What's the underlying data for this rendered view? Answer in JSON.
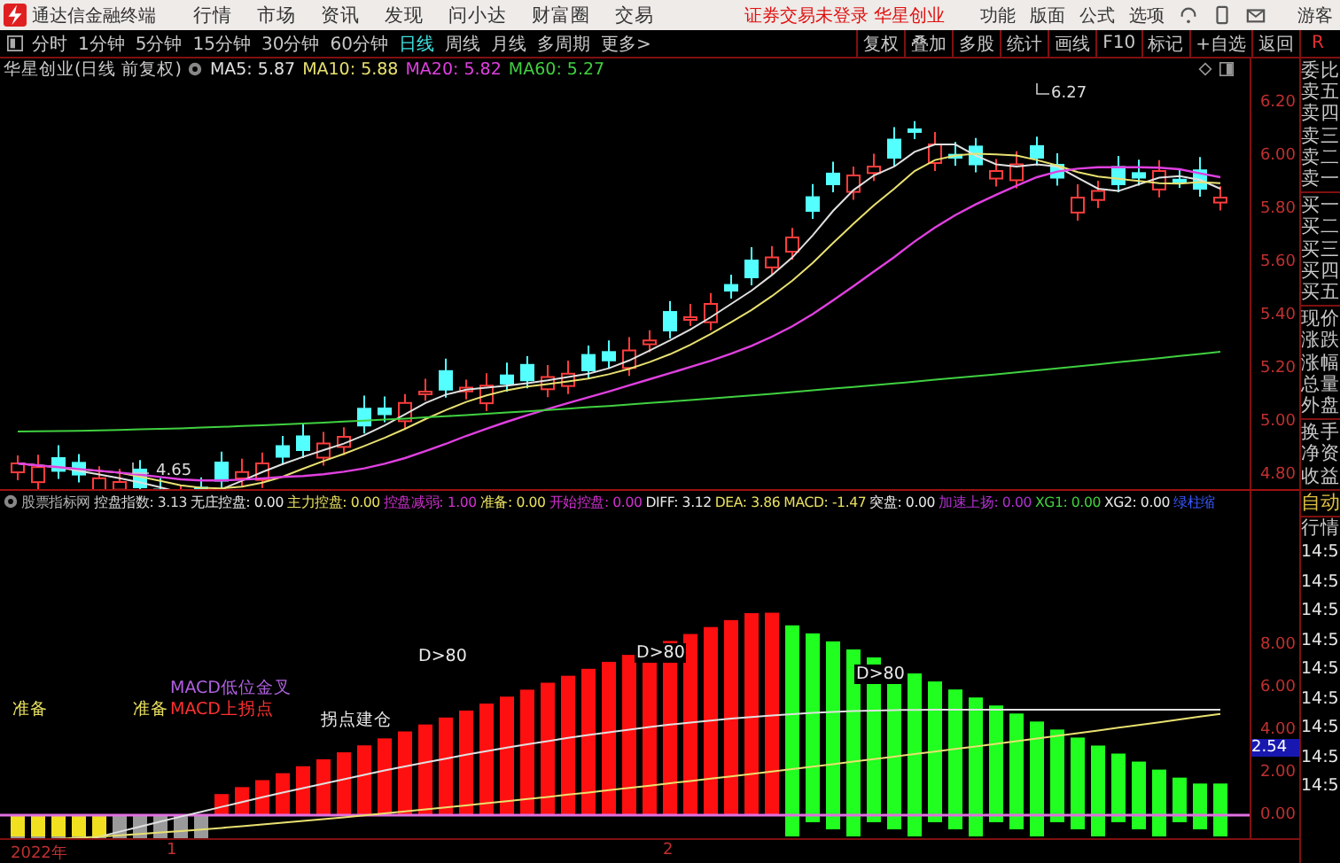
{
  "app": {
    "title": "通达信金融终端"
  },
  "menu": [
    "行情",
    "市场",
    "资讯",
    "发现",
    "问小达",
    "财富圈",
    "交易"
  ],
  "login_notice": "证券交易未登录 华星创业",
  "menu_right": [
    "功能",
    "版面",
    "公式",
    "选项"
  ],
  "user": "游客",
  "period_tabs": [
    {
      "label": "分时",
      "selected": false
    },
    {
      "label": "1分钟",
      "selected": false
    },
    {
      "label": "5分钟",
      "selected": false
    },
    {
      "label": "15分钟",
      "selected": false
    },
    {
      "label": "30分钟",
      "selected": false
    },
    {
      "label": "60分钟",
      "selected": false
    },
    {
      "label": "日线",
      "selected": true
    },
    {
      "label": "周线",
      "selected": false
    },
    {
      "label": "月线",
      "selected": false
    },
    {
      "label": "多周期",
      "selected": false
    },
    {
      "label": "更多>",
      "selected": false
    }
  ],
  "toolbar_buttons": [
    "复权",
    "叠加",
    "多股",
    "统计",
    "画线",
    "F10",
    "标记",
    "+自选",
    "返回"
  ],
  "toolbar_right": "R",
  "main_chart": {
    "title": "华星创业(日线 前复权)",
    "indicators": [
      {
        "label": "MA5: 5.87",
        "color": "#e0e0e0"
      },
      {
        "label": "MA10: 5.88",
        "color": "#e8e070"
      },
      {
        "label": "MA20: 5.82",
        "color": "#e040e0"
      },
      {
        "label": "MA60: 5.27",
        "color": "#40d040"
      }
    ],
    "high_label": "6.27",
    "low_label": "4.65",
    "axis_labels": [
      "6.20",
      "6.00",
      "5.80",
      "5.60",
      "5.40",
      "5.20",
      "5.00",
      "4.80"
    ]
  },
  "indicator_panel": {
    "items": [
      {
        "label": "股票指标网",
        "color": "#b0b0b0"
      },
      {
        "label": "控盘指数: 3.13",
        "color": "#d8d8d8"
      },
      {
        "label": "无庄控盘: 0.00",
        "color": "#e8e8e8"
      },
      {
        "label": "主力控盘: 0.00",
        "color": "#e8e060"
      },
      {
        "label": "控盘减弱: 1.00",
        "color": "#d030d0"
      },
      {
        "label": "准备: 0.00",
        "color": "#e8e060"
      },
      {
        "label": "开始控盘: 0.00",
        "color": "#d030d0"
      },
      {
        "label": "DIFF: 3.12",
        "color": "#e8e8e8"
      },
      {
        "label": "DEA: 3.86",
        "color": "#e8e060"
      },
      {
        "label": "MACD: -1.47",
        "color": "#e8e060"
      },
      {
        "label": "突盘: 0.00",
        "color": "#e8e8e8"
      },
      {
        "label": "加速上扬: 0.00",
        "color": "#b030d0"
      },
      {
        "label": "XG1: 0.00",
        "color": "#40d040"
      },
      {
        "label": "XG2: 0.00",
        "color": "#e8e8e8"
      },
      {
        "label": "绿柱缩",
        "color": "#3858ff"
      }
    ],
    "annotations": [
      {
        "text": "准备",
        "kind": "ready"
      },
      {
        "text": "准备",
        "kind": "ready"
      },
      {
        "text": "MACD上拐点",
        "kind": "signal"
      },
      {
        "text": "MACD低位金叉",
        "kind": "cross"
      },
      {
        "text": "拐点建仓",
        "kind": "note"
      },
      {
        "text": "D>80",
        "kind": "note"
      },
      {
        "text": "D>80",
        "kind": "note"
      },
      {
        "text": "D>80",
        "kind": "note"
      }
    ],
    "axis_labels": [
      "8.00",
      "6.00",
      "4.00",
      "2.00",
      "0.00"
    ],
    "current_value": "2.54"
  },
  "x_axis": [
    "2022年",
    "1",
    "2"
  ],
  "quote_panel": {
    "groups": [
      [
        "委比",
        "卖五",
        "卖四",
        "卖三",
        "卖二",
        "卖一"
      ],
      [
        "买一",
        "买二",
        "买三",
        "买四",
        "买五"
      ],
      [
        "现价",
        "涨跌",
        "涨幅",
        "总量",
        "外盘"
      ],
      [
        "换手",
        "净资",
        "收益"
      ]
    ],
    "auto": "自动",
    "market": "行情",
    "times": [
      "14:5",
      "14:5",
      "14:5",
      "14:5",
      "14:5",
      "14:5",
      "14:5",
      "14:5",
      "14:5"
    ]
  }
}
